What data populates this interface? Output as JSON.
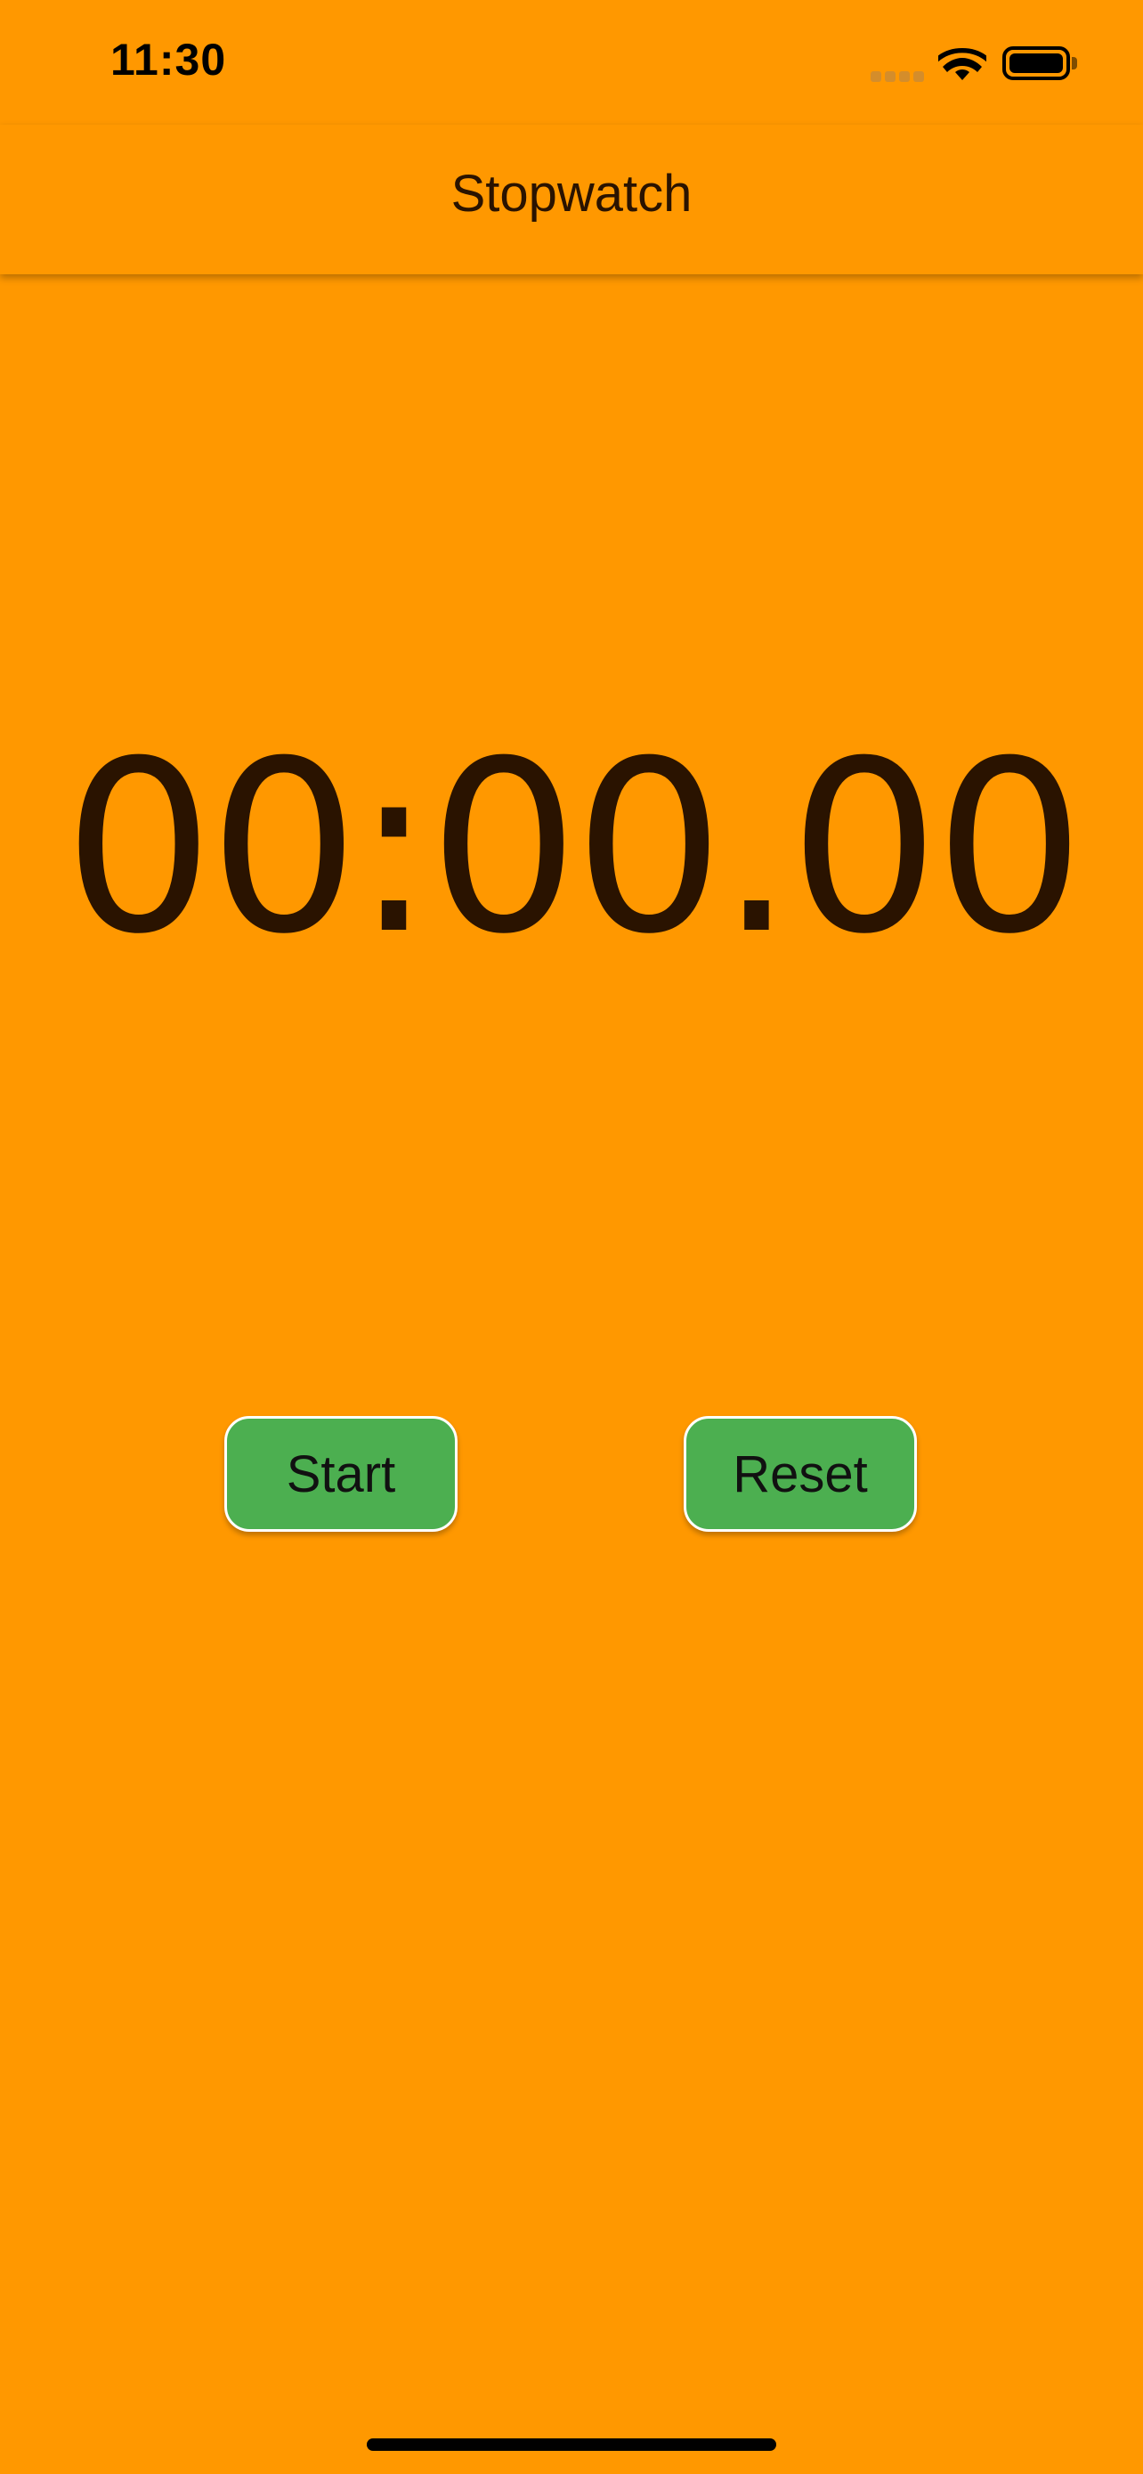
{
  "status_bar": {
    "time": "11:30",
    "wifi_icon": "wifi-icon",
    "battery_icon": "battery-icon",
    "signal_icon": "cellular-signal-icon"
  },
  "app_bar": {
    "title": "Stopwatch"
  },
  "stopwatch": {
    "display": "00:00.00"
  },
  "controls": {
    "start_label": "Start",
    "reset_label": "Reset"
  },
  "colors": {
    "background": "#FF9800",
    "button": "#4CAF50",
    "text": "#2A1300"
  }
}
